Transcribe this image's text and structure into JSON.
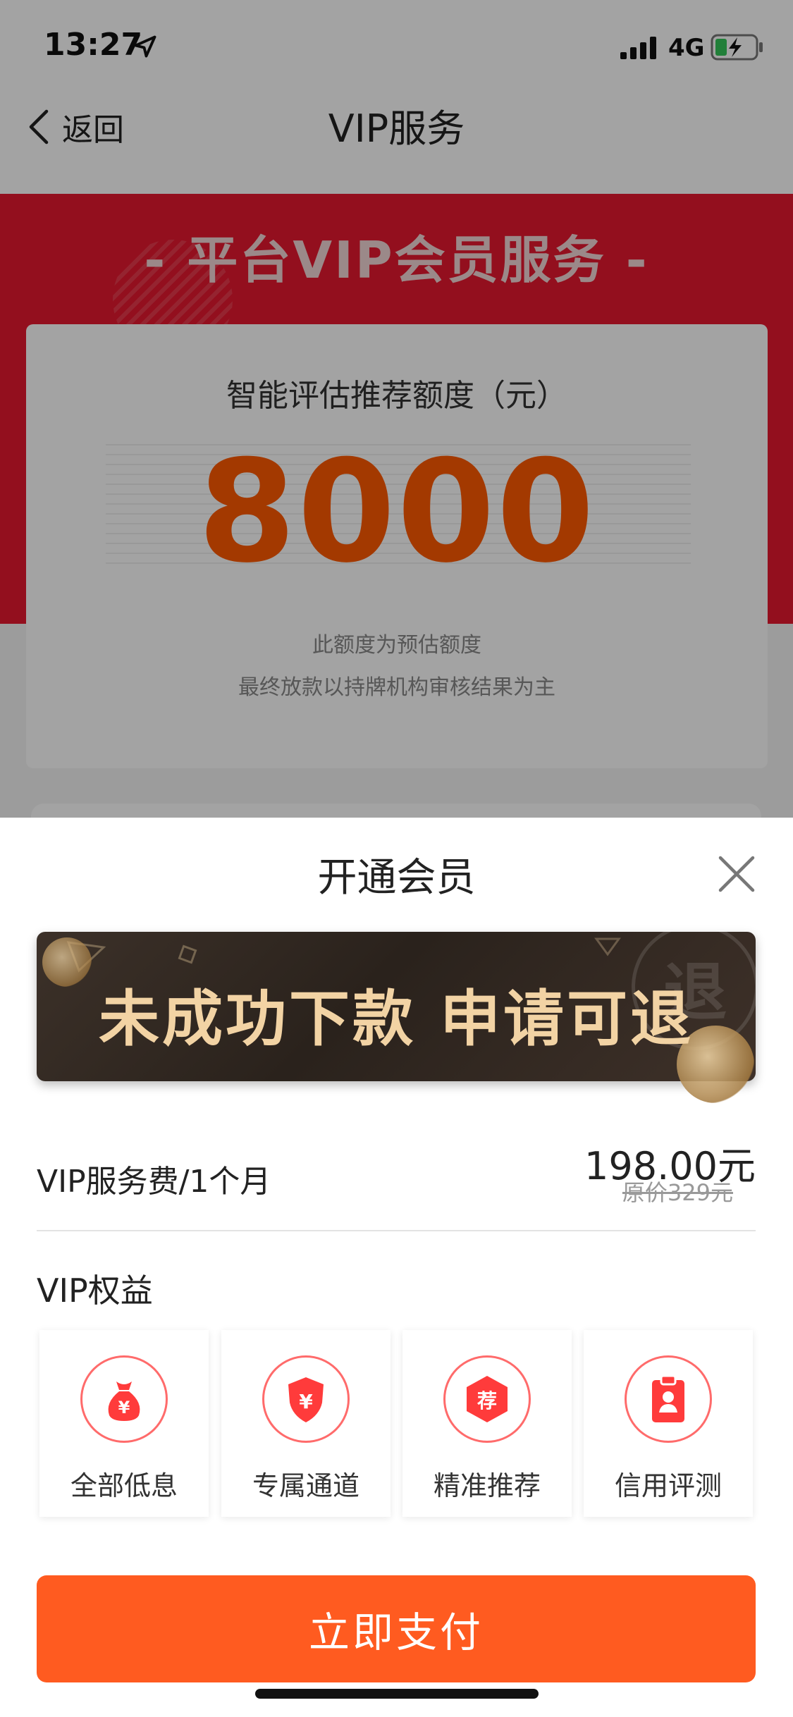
{
  "status_bar": {
    "time": "13:27",
    "network": "4G"
  },
  "nav": {
    "back_label": "返回",
    "title": "VIP服务"
  },
  "hero": {
    "title": "- 平台VIP会员服务 -"
  },
  "quota": {
    "label": "智能评估推荐额度（元）",
    "amount": "8000",
    "note_1": "此额度为预估额度",
    "note_2": "最终放款以持牌机构审核结果为主"
  },
  "sheet": {
    "title": "开通会员",
    "banner_text": "未成功下款 申请可退",
    "banner_stamp": "退",
    "fee": {
      "label": "VIP服务费/1个月",
      "price": "198.00元",
      "original_price": "原价329元"
    },
    "benefits_title": "VIP权益",
    "benefits": [
      {
        "label": "全部低息",
        "icon": "money-bag-icon"
      },
      {
        "label": "专属通道",
        "icon": "shield-yen-icon"
      },
      {
        "label": "精准推荐",
        "icon": "recommend-badge-icon",
        "glyph": "荐"
      },
      {
        "label": "信用评测",
        "icon": "clipboard-user-icon"
      }
    ],
    "pay_button": "立即支付"
  },
  "colors": {
    "accent": "#ff5b20",
    "hero_red": "#e6182f",
    "icon_red": "#ff3b3b",
    "banner_gold": "#f2d3a4"
  }
}
